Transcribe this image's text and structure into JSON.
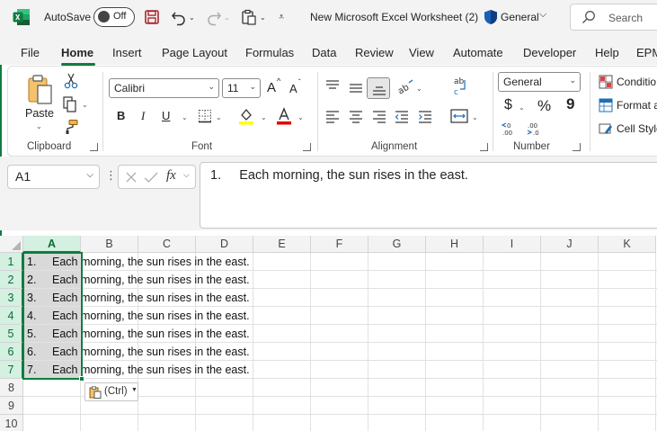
{
  "titlebar": {
    "autosave_label": "AutoSave",
    "autosave_state": "Off",
    "document_title": "New Microsoft Excel Worksheet (2)",
    "sensitivity_label": "General",
    "search_placeholder": "Search"
  },
  "tabs": [
    "File",
    "Home",
    "Insert",
    "Page Layout",
    "Formulas",
    "Data",
    "Review",
    "View",
    "Automate",
    "Developer",
    "Help",
    "EPM"
  ],
  "active_tab": "Home",
  "ribbon": {
    "clipboard": {
      "paste_label": "Paste",
      "group_label": "Clipboard"
    },
    "font": {
      "font_name": "Calibri",
      "font_size": "11",
      "grow_label": "A",
      "shrink_label": "A",
      "bold_label": "B",
      "italic_label": "I",
      "underline_label": "U",
      "group_label": "Font"
    },
    "alignment": {
      "group_label": "Alignment"
    },
    "number": {
      "format": "General",
      "currency_label": "$",
      "percent_label": "%",
      "comma_label": "9",
      "group_label": "Number"
    },
    "styles": {
      "conditional": "Conditio",
      "format_as": "Format a",
      "cell_styles": "Cell Style"
    }
  },
  "formula_bar": {
    "name_box": "A1",
    "formula": "1.     Each morning, the sun rises in the east."
  },
  "grid": {
    "columns": [
      "A",
      "B",
      "C",
      "D",
      "E",
      "F",
      "G",
      "H",
      "I",
      "J",
      "K"
    ],
    "rows": [
      "1",
      "2",
      "3",
      "4",
      "5",
      "6",
      "7",
      "8",
      "9",
      "10"
    ],
    "cells": [
      {
        "num": "1.",
        "text": "Each morning, the sun rises in the east."
      },
      {
        "num": "2.",
        "text": "Each morning, the sun rises in the east."
      },
      {
        "num": "3.",
        "text": "Each morning, the sun rises in the east."
      },
      {
        "num": "4.",
        "text": "Each morning, the sun rises in the east."
      },
      {
        "num": "5.",
        "text": "Each morning, the sun rises in the east."
      },
      {
        "num": "6.",
        "text": "Each morning, the sun rises in the east."
      },
      {
        "num": "7.",
        "text": "Each morning, the sun rises in the east."
      }
    ],
    "paste_options_label": "(Ctrl)"
  },
  "colors": {
    "accent": "#107c41",
    "selection_fill": "#d9d9d9"
  }
}
